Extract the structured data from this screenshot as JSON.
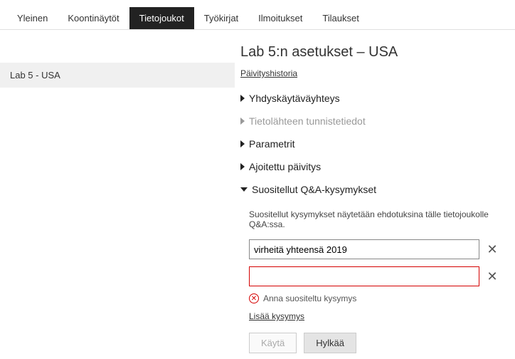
{
  "tabs": {
    "general": "Yleinen",
    "dashboards": "Koontinäytöt",
    "datasets": "Tietojoukot",
    "workbooks": "Työkirjat",
    "alerts": "Ilmoitukset",
    "subscriptions": "Tilaukset"
  },
  "sidebar": {
    "item0": "Lab 5 - USA"
  },
  "main": {
    "title": "Lab 5:n asetukset – USA",
    "historyLink": "Päivityshistoria",
    "sections": {
      "gateway": "Yhdyskäytäväyhteys",
      "credentials": "Tietolähteen tunnistetiedot",
      "parameters": "Parametrit",
      "scheduled": "Ajoitettu päivitys",
      "qna": "Suositellut Q&A-kysymykset"
    },
    "qna": {
      "description": "Suositellut kysymykset näytetään ehdotuksina tälle tietojoukolle Q&A:ssa.",
      "q1": "virheitä yhteensä 2019",
      "q2": "",
      "errorMsg": "Anna suositeltu kysymys",
      "addLink": "Lisää kysymys",
      "applyBtn": "Käytä",
      "discardBtn": "Hylkää"
    }
  }
}
